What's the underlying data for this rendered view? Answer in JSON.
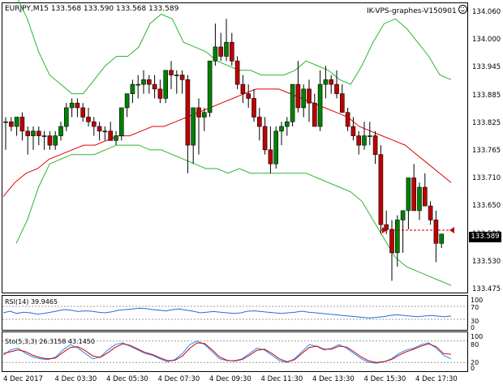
{
  "chart": {
    "symbol_info": "EURJPY,M15  133.568 133.590 133.568 133.589",
    "expert_label": "IK-VPS-graphes-V150901",
    "current_price": "133.589",
    "price_axis": [
      "134.060",
      "134.000",
      "133.945",
      "133.885",
      "133.825",
      "133.765",
      "133.710",
      "133.650",
      "133.590",
      "133.530",
      "133.475"
    ],
    "time_axis": [
      "4 Dec 2017",
      "4 Dec 03:30",
      "4 Dec 05:30",
      "4 Dec 07:30",
      "4 Dec 09:30",
      "4 Dec 11:30",
      "4 Dec 13:30",
      "4 Dec 15:30",
      "4 Dec 17:30"
    ],
    "colors": {
      "bull": "#008000",
      "bear": "#c00000",
      "ma": "#e00000",
      "bands": "#2db52d",
      "rsi": "#1e6fd9",
      "stoch_main": "#1e90ff",
      "stoch_signal": "#d00000"
    }
  },
  "rsi": {
    "label": "RSI(14) 39.9465",
    "levels": [
      "100",
      "70",
      "30",
      "0"
    ]
  },
  "stoch": {
    "label": "Sto(5,3,3) 26.3158 43.1450",
    "levels": [
      "100",
      "80",
      "20",
      "0"
    ]
  },
  "chart_data": {
    "type": "candlestick",
    "ylim": [
      133.47,
      134.08
    ],
    "candles": [
      [
        133.83,
        133.84,
        133.77,
        133.83
      ],
      [
        133.83,
        133.84,
        133.81,
        133.82
      ],
      [
        133.82,
        133.84,
        133.8,
        133.84
      ],
      [
        133.84,
        133.85,
        133.79,
        133.81
      ],
      [
        133.81,
        133.82,
        133.76,
        133.8
      ],
      [
        133.8,
        133.82,
        133.77,
        133.81
      ],
      [
        133.81,
        133.82,
        133.78,
        133.8
      ],
      [
        133.8,
        133.81,
        133.77,
        133.8
      ],
      [
        133.8,
        133.81,
        133.77,
        133.78
      ],
      [
        133.78,
        133.81,
        133.77,
        133.8
      ],
      [
        133.8,
        133.83,
        133.79,
        133.82
      ],
      [
        133.82,
        133.87,
        133.81,
        133.86
      ],
      [
        133.86,
        133.88,
        133.84,
        133.87
      ],
      [
        133.87,
        133.88,
        133.84,
        133.86
      ],
      [
        133.86,
        133.87,
        133.83,
        133.84
      ],
      [
        133.84,
        133.86,
        133.82,
        133.83
      ],
      [
        133.83,
        133.84,
        133.8,
        133.82
      ],
      [
        133.82,
        133.83,
        133.79,
        133.81
      ],
      [
        133.81,
        133.82,
        133.79,
        133.81
      ],
      [
        133.81,
        133.83,
        133.79,
        133.79
      ],
      [
        133.79,
        133.81,
        133.78,
        133.8
      ],
      [
        133.8,
        133.86,
        133.79,
        133.86
      ],
      [
        133.86,
        133.89,
        133.84,
        133.89
      ],
      [
        133.89,
        133.92,
        133.87,
        133.91
      ],
      [
        133.91,
        133.93,
        133.88,
        133.91
      ],
      [
        133.91,
        133.94,
        133.89,
        133.92
      ],
      [
        133.92,
        133.93,
        133.89,
        133.91
      ],
      [
        133.91,
        133.93,
        133.88,
        133.9
      ],
      [
        133.9,
        133.92,
        133.87,
        133.88
      ],
      [
        133.88,
        133.94,
        133.87,
        133.94
      ],
      [
        133.94,
        133.96,
        133.9,
        133.93
      ],
      [
        133.93,
        133.94,
        133.89,
        133.93
      ],
      [
        133.93,
        133.94,
        133.89,
        133.92
      ],
      [
        133.92,
        133.93,
        133.72,
        133.78
      ],
      [
        133.78,
        133.86,
        133.74,
        133.86
      ],
      [
        133.86,
        133.88,
        133.76,
        133.84
      ],
      [
        133.84,
        133.86,
        133.81,
        133.85
      ],
      [
        133.85,
        133.96,
        133.84,
        133.96
      ],
      [
        133.96,
        134.04,
        133.95,
        133.99
      ],
      [
        133.99,
        134.02,
        133.96,
        133.97
      ],
      [
        133.97,
        134.05,
        133.96,
        134.0
      ],
      [
        134.0,
        134.02,
        133.95,
        133.96
      ],
      [
        133.96,
        133.97,
        133.9,
        133.91
      ],
      [
        133.91,
        133.93,
        133.87,
        133.89
      ],
      [
        133.89,
        133.91,
        133.86,
        133.88
      ],
      [
        133.88,
        133.9,
        133.83,
        133.84
      ],
      [
        133.84,
        133.86,
        133.79,
        133.82
      ],
      [
        133.82,
        133.84,
        133.76,
        133.77
      ],
      [
        133.77,
        133.82,
        133.72,
        133.74
      ],
      [
        133.74,
        133.82,
        133.73,
        133.81
      ],
      [
        133.81,
        133.83,
        133.78,
        133.82
      ],
      [
        133.82,
        133.84,
        133.8,
        133.83
      ],
      [
        133.83,
        133.91,
        133.82,
        133.91
      ],
      [
        133.91,
        133.96,
        133.85,
        133.86
      ],
      [
        133.86,
        133.91,
        133.84,
        133.9
      ],
      [
        133.9,
        133.92,
        133.83,
        133.87
      ],
      [
        133.87,
        133.89,
        133.82,
        133.82
      ],
      [
        133.82,
        133.94,
        133.81,
        133.91
      ],
      [
        133.91,
        133.95,
        133.88,
        133.92
      ],
      [
        133.92,
        133.93,
        133.89,
        133.91
      ],
      [
        133.91,
        133.94,
        133.88,
        133.89
      ],
      [
        133.89,
        133.91,
        133.85,
        133.85
      ],
      [
        133.85,
        133.86,
        133.81,
        133.82
      ],
      [
        133.82,
        133.84,
        133.79,
        133.8
      ],
      [
        133.8,
        133.81,
        133.76,
        133.78
      ],
      [
        133.78,
        133.83,
        133.77,
        133.8
      ],
      [
        133.8,
        133.83,
        133.78,
        133.8
      ],
      [
        133.8,
        133.81,
        133.74,
        133.76
      ],
      [
        133.76,
        133.78,
        133.59,
        133.61
      ],
      [
        133.61,
        133.64,
        133.59,
        133.6
      ],
      [
        133.6,
        133.62,
        133.49,
        133.55
      ],
      [
        133.55,
        133.63,
        133.52,
        133.62
      ],
      [
        133.62,
        133.64,
        133.55,
        133.64
      ],
      [
        133.64,
        133.71,
        133.6,
        133.71
      ],
      [
        133.71,
        133.74,
        133.64,
        133.64
      ],
      [
        133.64,
        133.7,
        133.62,
        133.69
      ],
      [
        133.69,
        133.72,
        133.65,
        133.65
      ],
      [
        133.65,
        133.66,
        133.61,
        133.62
      ],
      [
        133.62,
        133.64,
        133.53,
        133.57
      ],
      [
        133.57,
        133.59,
        133.56,
        133.59
      ]
    ],
    "ma": [
      133.67,
      133.7,
      133.72,
      133.73,
      133.75,
      133.76,
      133.77,
      133.78,
      133.78,
      133.79,
      133.8,
      133.8,
      133.81,
      133.82,
      133.82,
      133.83,
      133.84,
      133.85,
      133.86,
      133.87,
      133.88,
      133.89,
      133.9,
      133.9,
      133.9,
      133.89,
      133.88,
      133.87,
      133.86,
      133.85,
      133.84,
      133.82,
      133.81,
      133.8,
      133.79,
      133.78,
      133.76,
      133.74,
      133.72,
      133.7
    ],
    "bb_upper": [
      134.1,
      134.05,
      133.98,
      133.93,
      133.91,
      133.89,
      133.89,
      133.92,
      133.95,
      133.97,
      133.97,
      133.99,
      134.04,
      134.06,
      134.05,
      134.0,
      133.99,
      133.98,
      133.96,
      133.95,
      133.94,
      133.94,
      133.93,
      133.93,
      133.93,
      133.94,
      133.96,
      133.95,
      133.94,
      133.92,
      133.91,
      133.95,
      134.0,
      134.04,
      134.05,
      134.03,
      134.0,
      133.97,
      133.93,
      133.92
    ],
    "bb_lower": [
      133.57,
      133.62,
      133.69,
      133.74,
      133.75,
      133.76,
      133.76,
      133.76,
      133.77,
      133.78,
      133.78,
      133.78,
      133.77,
      133.77,
      133.76,
      133.75,
      133.74,
      133.73,
      133.73,
      133.72,
      133.73,
      133.72,
      133.72,
      133.72,
      133.72,
      133.72,
      133.72,
      133.71,
      133.7,
      133.69,
      133.68,
      133.66,
      133.62,
      133.58,
      133.54,
      133.52,
      133.51,
      133.5,
      133.49,
      133.48
    ],
    "rsi_values": [
      50,
      55,
      48,
      52,
      50,
      46,
      48,
      52,
      56,
      60,
      58,
      54,
      56,
      55,
      52,
      50,
      53,
      58,
      60,
      62,
      64,
      63,
      60,
      58,
      56,
      60,
      62,
      58,
      55,
      50,
      52,
      54,
      52,
      50,
      48,
      50,
      55,
      56,
      54,
      52,
      50,
      48,
      50,
      52,
      55,
      52,
      50,
      48,
      46,
      44,
      42,
      40,
      38,
      36,
      34,
      36,
      38,
      42,
      44,
      42,
      40,
      38,
      40,
      42,
      40,
      38,
      40
    ],
    "stoch_main": [
      40,
      55,
      60,
      45,
      35,
      30,
      28,
      35,
      55,
      70,
      60,
      45,
      30,
      35,
      55,
      70,
      75,
      65,
      55,
      45,
      40,
      30,
      22,
      28,
      45,
      70,
      80,
      70,
      50,
      30,
      25,
      25,
      30,
      45,
      60,
      55,
      40,
      25,
      20,
      30,
      50,
      70,
      65,
      55,
      60,
      70,
      60,
      45,
      30,
      20,
      18,
      22,
      30,
      45,
      55,
      60,
      70,
      75,
      60,
      40,
      30
    ],
    "stoch_signal": [
      45,
      50,
      55,
      50,
      40,
      33,
      30,
      32,
      48,
      62,
      64,
      53,
      38,
      34,
      47,
      62,
      72,
      68,
      58,
      48,
      42,
      33,
      25,
      26,
      38,
      60,
      75,
      73,
      55,
      35,
      26,
      24,
      28,
      40,
      54,
      57,
      45,
      30,
      22,
      27,
      45,
      62,
      66,
      57,
      57,
      66,
      63,
      50,
      35,
      24,
      20,
      22,
      28,
      40,
      50,
      57,
      66,
      72,
      64,
      45,
      43
    ]
  }
}
